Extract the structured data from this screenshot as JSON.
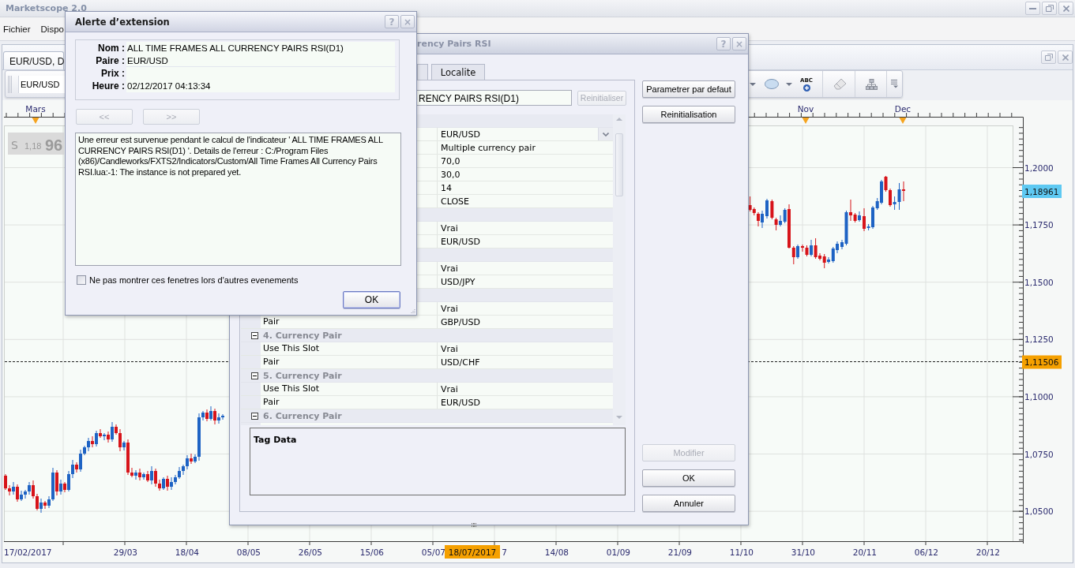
{
  "app": {
    "title": "Marketscope 2.0"
  },
  "menu": [
    {
      "label": "Fichier"
    },
    {
      "label": "Dispo"
    }
  ],
  "chart_window": {
    "tab": {
      "label": "EUR/USD, D",
      "selected": true
    },
    "toolbar": {
      "symbol": "EUR/USD",
      "text_tool": "ABC"
    },
    "price_box": {
      "side": "S",
      "big_figure": "1,18",
      "pips": "96"
    },
    "months": [
      "Mars",
      "Nov",
      "Dec"
    ],
    "price_ticks": [
      "1,2000",
      "1,1750",
      "1,1500",
      "1,1250",
      "1,1000",
      "1,0750",
      "1,0500"
    ],
    "date_ticks": [
      "17/02/2017",
      "29/03",
      "18/04",
      "08/05",
      "26/05",
      "15/06",
      "05/07",
      "7",
      "14/08",
      "01/09",
      "21/09",
      "11/10",
      "31/10",
      "20/11",
      "06/12",
      "20/12"
    ],
    "current_price": "1,18961",
    "crosshair": {
      "price": "1,11506",
      "date": "18/07/2017"
    }
  },
  "properties_dialog": {
    "title": "rency Pairs RSI",
    "title_buttons": [
      "?",
      "×"
    ],
    "tabs": [
      {
        "label": "Localite",
        "selected": false
      }
    ],
    "name_field": {
      "value": "RENCY PAIRS RSI(D1)"
    },
    "reset_button": {
      "label": "Reinitialiser",
      "disabled": true
    },
    "groups": [
      {
        "children": [
          {
            "kind": "dropdown",
            "value": "EUR/USD"
          },
          {
            "kind": "text",
            "value": "Multiple currency pair"
          },
          {
            "kind": "text",
            "value": "70,0"
          },
          {
            "kind": "text",
            "value": "30,0"
          },
          {
            "kind": "text",
            "value": "14"
          },
          {
            "kind": "text",
            "value": "CLOSE"
          }
        ]
      },
      {
        "children": [
          {
            "kind": "text",
            "value": "Vrai"
          },
          {
            "kind": "text",
            "value": "EUR/USD"
          }
        ]
      },
      {
        "children": [
          {
            "kind": "text",
            "value": "Vrai"
          },
          {
            "kind": "text",
            "value": "USD/JPY"
          }
        ]
      },
      {
        "children": [
          {
            "kind": "text",
            "value": "Vrai"
          },
          {
            "kind": "text",
            "label": "Pair",
            "value": "GBP/USD"
          }
        ]
      },
      {
        "label": "4. Currency Pair",
        "expanded": true,
        "children": [
          {
            "kind": "text",
            "label": "Use This Slot",
            "value": "Vrai"
          },
          {
            "kind": "text",
            "label": "Pair",
            "value": "USD/CHF"
          }
        ]
      },
      {
        "label": "5. Currency Pair",
        "expanded": true,
        "children": [
          {
            "kind": "text",
            "label": "Use This Slot",
            "value": "Vrai"
          },
          {
            "kind": "text",
            "label": "Pair",
            "value": "EUR/USD"
          }
        ]
      },
      {
        "label": "6. Currency Pair",
        "expanded": true
      }
    ],
    "tag_data": {
      "title": "Tag Data"
    },
    "side_buttons": [
      {
        "label": "Parametrer par defaut",
        "disabled": false
      },
      {
        "label": "Reinitialisation",
        "disabled": false
      }
    ],
    "bottom_buttons": [
      {
        "label": "Modifier",
        "disabled": true
      },
      {
        "label": "OK",
        "disabled": false
      },
      {
        "label": "Annuler",
        "disabled": false
      }
    ]
  },
  "alert_dialog": {
    "title": "Alerte d’extension",
    "title_buttons": [
      "?",
      "×"
    ],
    "fields": [
      {
        "label": "Nom :",
        "value": "ALL TIME FRAMES ALL CURRENCY PAIRS RSI(D1)"
      },
      {
        "label": "Paire :",
        "value": "EUR/USD"
      },
      {
        "label": "Prix :"
      },
      {
        "label": "Heure :",
        "value": "02/12/2017 04:13:34"
      }
    ],
    "nav_buttons": [
      {
        "label": "<<",
        "disabled": true
      },
      {
        "label": ">>",
        "disabled": true
      }
    ],
    "message": "Une erreur est survenue pendant le calcul de l'indicateur ' ALL TIME FRAMES ALL CURRENCY PAIRS RSI(D1) '. Details de l'erreur : C:/Program Files (x86)/Candleworks/FXTS2/Indicators/Custom/All Time Frames All Currency Pairs RSI.lua:-1: The instance is not prepared yet.",
    "checkbox": {
      "label": "Ne pas montrer ces fenetres lors d'autres evenements",
      "checked": false
    },
    "ok_button": {
      "label": "OK",
      "default": true
    }
  }
}
